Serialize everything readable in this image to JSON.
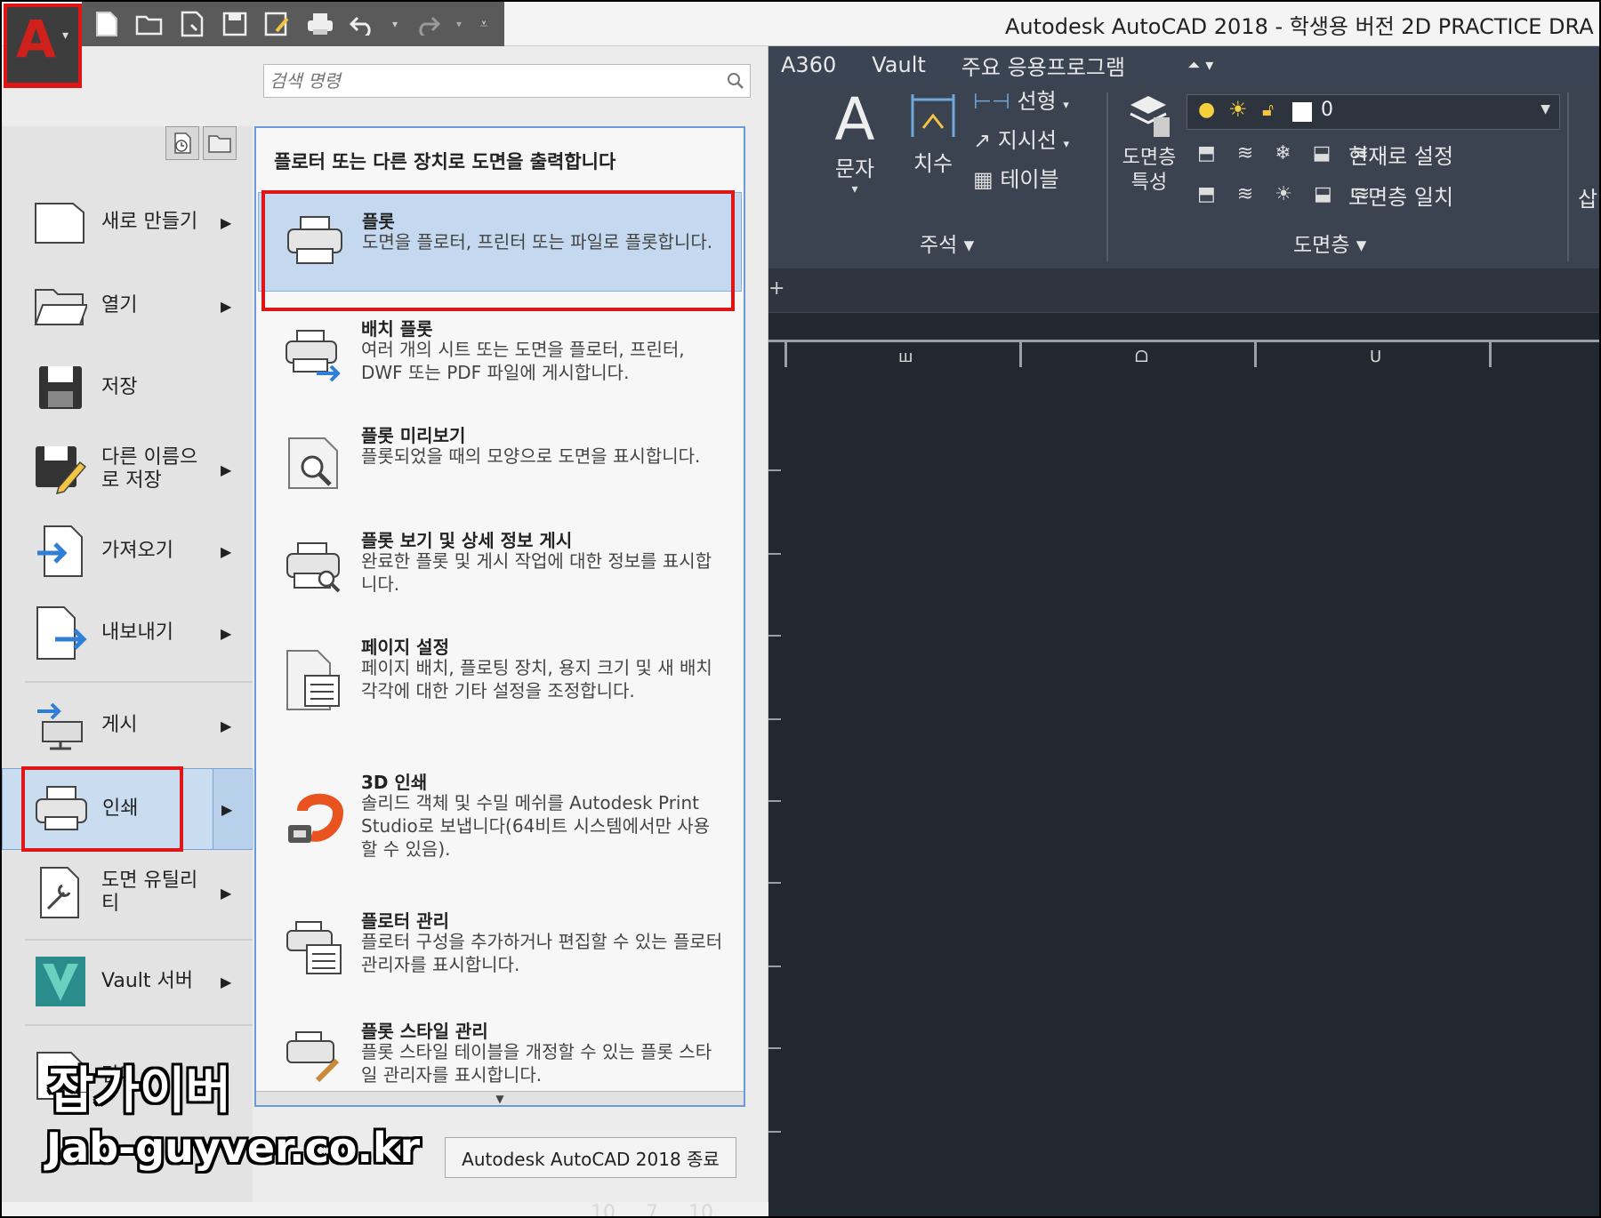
{
  "window": {
    "title": "Autodesk AutoCAD 2018 - 학생용 버전    2D PRACTICE DRA"
  },
  "app_button": {
    "letter": "A"
  },
  "ribbon": {
    "tabs": [
      "A360",
      "Vault",
      "주요 응용프로그램"
    ],
    "annotation": {
      "text_label": "문자",
      "dim_label": "치수",
      "linear": "선형",
      "leader": "지시선",
      "table": "테이블",
      "panel_label": "주석"
    },
    "layers": {
      "properties_label": "도면층 특성",
      "current_layer": "0",
      "set_current": "현재로 설정",
      "match_layer": "도면층 일치",
      "panel_label": "도면층"
    },
    "insert_label": "삽"
  },
  "drawing": {
    "ruler_labels": [
      "ш",
      "ᗝ",
      "ᑌ"
    ],
    "bottom_labels": [
      "10",
      "7",
      "10"
    ]
  },
  "search": {
    "placeholder": "검색 명령"
  },
  "left_menu": [
    {
      "label": "새로 만들기",
      "icon": "new-document-icon",
      "arrow": true
    },
    {
      "label": "열기",
      "icon": "open-folder-icon",
      "arrow": true
    },
    {
      "label": "저장",
      "icon": "save-icon",
      "arrow": false
    },
    {
      "label": "다른 이름으로 저장",
      "icon": "save-as-icon",
      "arrow": true
    },
    {
      "label": "가져오기",
      "icon": "import-icon",
      "arrow": true
    },
    {
      "label": "내보내기",
      "icon": "export-icon",
      "arrow": true
    },
    {
      "label": "게시",
      "icon": "publish-icon",
      "arrow": true
    },
    {
      "label": "인쇄",
      "icon": "print-icon",
      "arrow": true,
      "selected": true
    },
    {
      "label": "도면 유틸리티",
      "icon": "drawing-utilities-icon",
      "arrow": true
    },
    {
      "label": "Vault 서버",
      "icon": "vault-icon",
      "arrow": true
    },
    {
      "label": "닫기",
      "icon": "close-document-icon",
      "arrow": false
    }
  ],
  "submenu": {
    "title": "플로터 또는 다른 장치로 도면을 출력합니다",
    "items": [
      {
        "title": "플롯",
        "desc": "도면을 플로터, 프린터 또는 파일로 플롯합니다.",
        "selected": true
      },
      {
        "title": "배치 플롯",
        "desc": "여러 개의 시트 또는 도면을 플로터, 프린터, DWF 또는 PDF 파일에 게시합니다."
      },
      {
        "title": "플롯 미리보기",
        "desc": "플롯되었을 때의 모양으로 도면을 표시합니다."
      },
      {
        "title": "플롯 보기 및 상세 정보 게시",
        "desc": "완료한 플롯 및 게시 작업에 대한 정보를 표시합니다."
      },
      {
        "title": "페이지 설정",
        "desc": "페이지 배치, 플로팅 장치, 용지 크기 및 새 배치 각각에 대한 기타 설정을 조정합니다."
      },
      {
        "title": "3D 인쇄",
        "desc": "솔리드 객체 및 수밀 메쉬를 Autodesk Print Studio로 보냅니다(64비트 시스템에서만 사용할 수 있음)."
      },
      {
        "title": "플로터 관리",
        "desc": "플로터 구성을 추가하거나 편집할 수 있는 플로터 관리자를 표시합니다."
      },
      {
        "title": "플롯 스타일 관리",
        "desc": "플롯 스타일 테이블을 개정할 수 있는 플롯 스타일 관리자를 표시합니다."
      }
    ]
  },
  "exit_button": "Autodesk AutoCAD 2018 종료",
  "watermark": {
    "line1": "잡가이버",
    "line2": "Jab-guyver.co.kr"
  },
  "colors": {
    "highlight": "#e01515",
    "selection": "#c4d9ef",
    "ribbon": "#3b4453",
    "canvas": "#212830"
  }
}
